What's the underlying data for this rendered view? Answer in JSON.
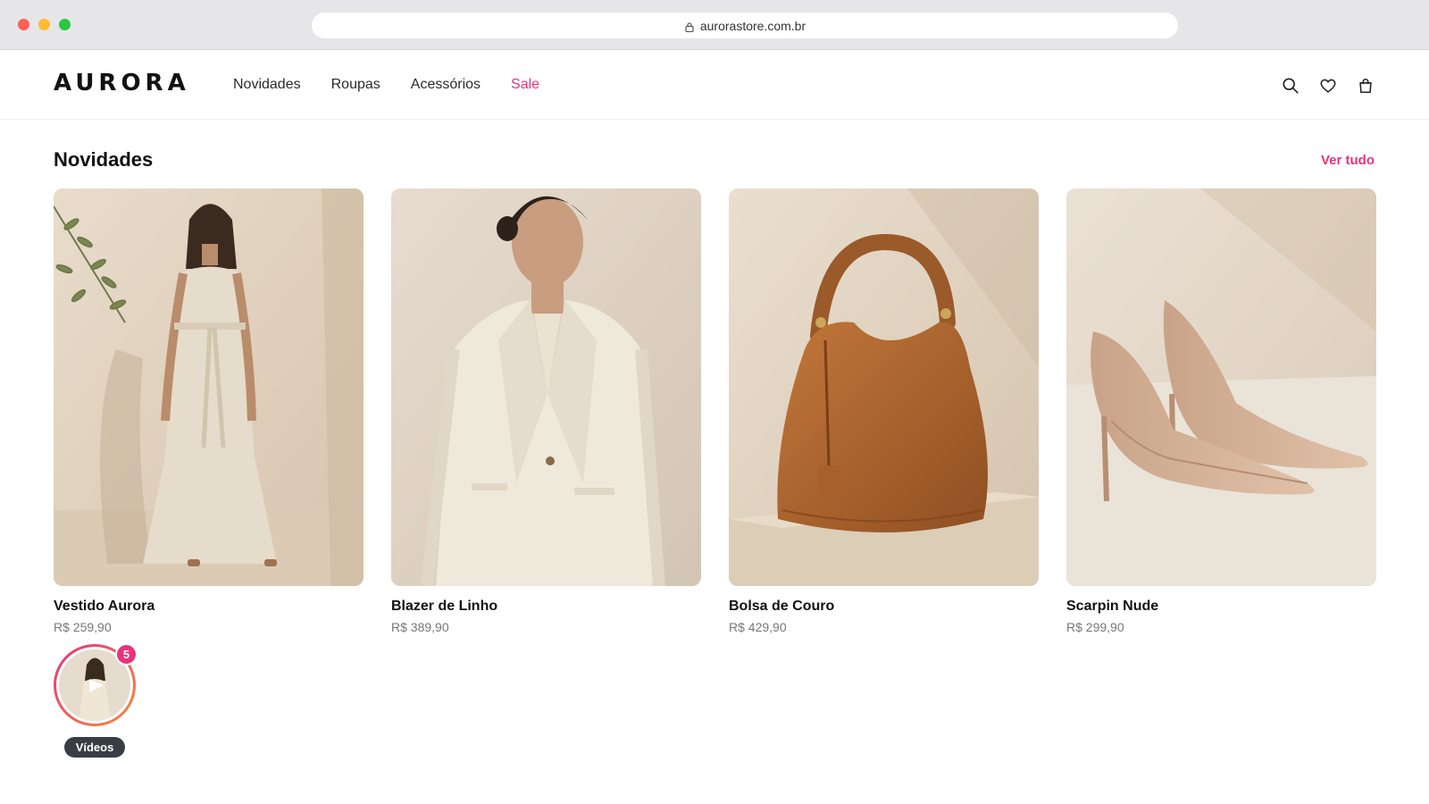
{
  "browser": {
    "url": "aurorastore.com.br"
  },
  "header": {
    "logo": "AURORA",
    "nav": [
      {
        "label": "Novidades"
      },
      {
        "label": "Roupas"
      },
      {
        "label": "Acessórios"
      },
      {
        "label": "Sale"
      }
    ],
    "icons": [
      "search-icon",
      "heart-icon",
      "bag-icon"
    ]
  },
  "section": {
    "title": "Novidades",
    "view_all": "Ver tudo"
  },
  "products": [
    {
      "name": "Vestido Aurora",
      "price": "R$ 259,90"
    },
    {
      "name": "Blazer de Linho",
      "price": "R$ 389,90"
    },
    {
      "name": "Bolsa de Couro",
      "price": "R$ 429,90"
    },
    {
      "name": "Scarpin Nude",
      "price": "R$ 299,90"
    }
  ],
  "videos": {
    "count": "5",
    "label": "Vídeos"
  },
  "colors": {
    "accent": "#e8337a",
    "text": "#111111",
    "muted": "#777777"
  }
}
